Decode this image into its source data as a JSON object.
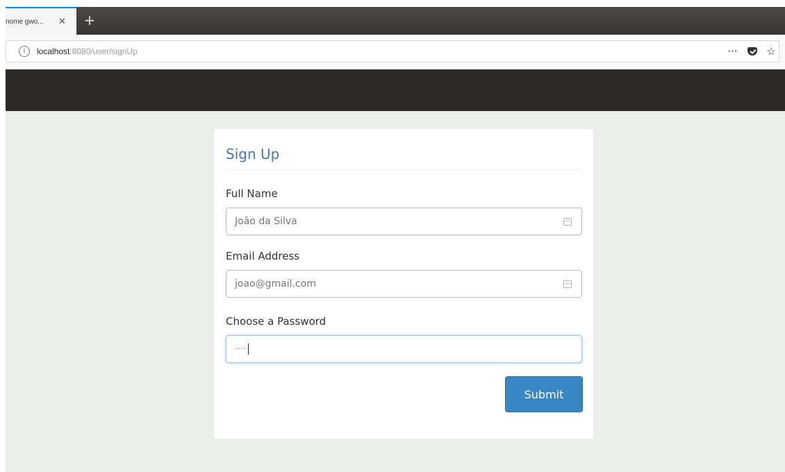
{
  "browser": {
    "tab": {
      "title": "nome gwo...",
      "close_glyph": "✕"
    },
    "new_tab_glyph": "+",
    "url": {
      "host": "localhost",
      "path": ":8080/user/signUp"
    },
    "actions": {
      "menu_glyph": "···",
      "bookmark_glyph": "☆"
    }
  },
  "form": {
    "title": "Sign Up",
    "fields": [
      {
        "label": "Full Name",
        "value": "João da Silva"
      },
      {
        "label": "Email Address",
        "value": "joao@gmail.com"
      },
      {
        "label": "Choose a Password",
        "value": "····"
      }
    ],
    "submit_label": "Submit"
  },
  "colors": {
    "title": "#4479b1",
    "submit": "#3a86c3",
    "appbar": "#2c2a28",
    "page_bg": "#eceeec"
  }
}
